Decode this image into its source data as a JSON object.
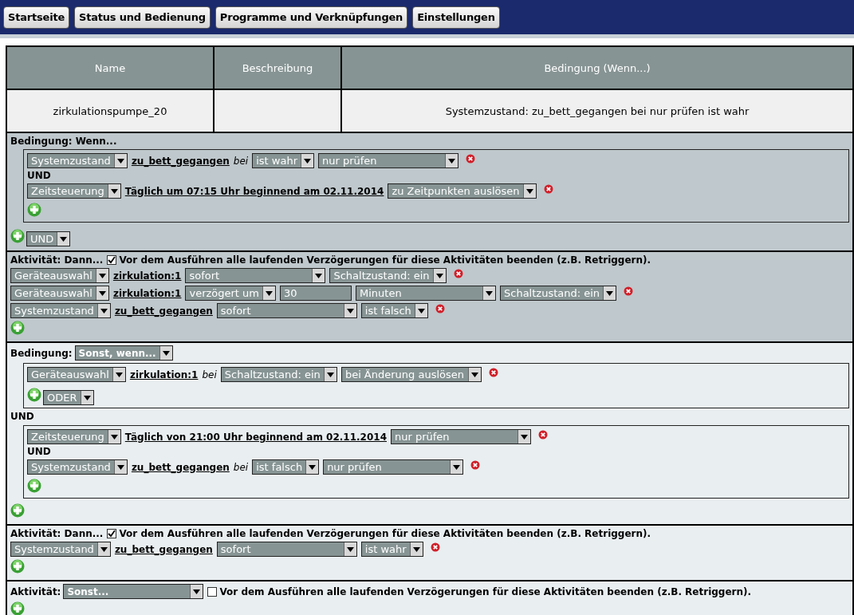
{
  "nav": [
    "Startseite",
    "Status und Bedienung",
    "Programme und Verknüpfungen",
    "Einstellungen"
  ],
  "table": {
    "columns": [
      "Name",
      "Beschreibung",
      "Bedingung (Wenn...)"
    ],
    "rows": [
      {
        "name": "zirkulationspumpe_20",
        "condition": "Systemzustand: zu_bett_gegangen bei nur prüfen ist wahr"
      }
    ]
  },
  "sections": [
    {
      "kind": "condition",
      "color": "#bfc8cc",
      "label": "Bedingung: Wenn...",
      "body": [
        {
          "kind": "group",
          "lines": [
            {
              "kind": "row",
              "parts": [
                {
                  "kind": "select",
                  "value": "Systemzustand"
                },
                {
                  "kind": "link",
                  "text": "zu_bett_gegangen"
                },
                {
                  "kind": "italic",
                  "text": "bei"
                },
                {
                  "kind": "select",
                  "value": "ist wahr"
                },
                {
                  "kind": "select",
                  "value": "nur prüfen",
                  "wide": true
                }
              ]
            },
            {
              "kind": "joiner",
              "text": "UND"
            },
            {
              "kind": "row",
              "parts": [
                {
                  "kind": "select",
                  "value": "Zeitsteuerung"
                },
                {
                  "kind": "link",
                  "text": "Täglich um 07:15 Uhr beginnend am 02.11.2014"
                },
                {
                  "kind": "select",
                  "value": "zu Zeitpunkten auslösen"
                }
              ]
            }
          ]
        }
      ],
      "operator": "UND"
    },
    {
      "kind": "activity",
      "color": "#bfc8cc",
      "label": "Aktivität: Dann...",
      "checked": true,
      "option": "Vor dem Ausführen alle laufenden Verzögerungen für diese Aktivitäten beenden (z.B. Retriggern).",
      "rows": [
        {
          "kind": "row",
          "parts": [
            {
              "kind": "select",
              "value": "Geräteauswahl"
            },
            {
              "kind": "link",
              "text": "zirkulation:1"
            },
            {
              "kind": "select",
              "value": "sofort",
              "wide": true
            },
            {
              "kind": "select",
              "value": "Schaltzustand: ein"
            }
          ]
        },
        {
          "kind": "row",
          "parts": [
            {
              "kind": "select",
              "value": "Geräteauswahl"
            },
            {
              "kind": "link",
              "text": "zirkulation:1"
            },
            {
              "kind": "select",
              "value": "verzögert um"
            },
            {
              "kind": "input",
              "value": "30"
            },
            {
              "kind": "select",
              "value": "Minuten",
              "wide": true
            },
            {
              "kind": "select",
              "value": "Schaltzustand: ein"
            }
          ]
        },
        {
          "kind": "row",
          "parts": [
            {
              "kind": "select",
              "value": "Systemzustand"
            },
            {
              "kind": "link",
              "text": "zu_bett_gegangen"
            },
            {
              "kind": "select",
              "value": "sofort",
              "wide": true
            },
            {
              "kind": "select",
              "value": "ist falsch"
            }
          ]
        }
      ]
    },
    {
      "kind": "condition",
      "color": "#e9eef0",
      "label": "Bedingung:",
      "mode": "Sonst, wenn...",
      "body": [
        {
          "kind": "group",
          "lines": [
            {
              "kind": "row",
              "parts": [
                {
                  "kind": "select",
                  "value": "Geräteauswahl"
                },
                {
                  "kind": "link",
                  "text": "zirkulation:1"
                },
                {
                  "kind": "italic",
                  "text": "bei"
                },
                {
                  "kind": "select",
                  "value": "Schaltzustand: ein"
                },
                {
                  "kind": "select",
                  "value": "bei Änderung auslösen",
                  "wide": true
                }
              ]
            }
          ],
          "operator": "ODER"
        },
        {
          "kind": "joiner",
          "text": "UND"
        },
        {
          "kind": "group",
          "lines": [
            {
              "kind": "row",
              "parts": [
                {
                  "kind": "select",
                  "value": "Zeitsteuerung"
                },
                {
                  "kind": "link",
                  "text": "Täglich von 21:00 Uhr beginnend am 02.11.2014"
                },
                {
                  "kind": "select",
                  "value": "nur prüfen",
                  "wide": true
                }
              ]
            },
            {
              "kind": "joiner",
              "text": "UND"
            },
            {
              "kind": "row",
              "parts": [
                {
                  "kind": "select",
                  "value": "Systemzustand"
                },
                {
                  "kind": "link",
                  "text": "zu_bett_gegangen"
                },
                {
                  "kind": "italic",
                  "text": "bei"
                },
                {
                  "kind": "select",
                  "value": "ist falsch"
                },
                {
                  "kind": "select",
                  "value": "nur prüfen",
                  "wide": true
                }
              ]
            }
          ]
        }
      ]
    },
    {
      "kind": "activity",
      "color": "#e9eef0",
      "label": "Aktivität: Dann...",
      "checked": true,
      "option": "Vor dem Ausführen alle laufenden Verzögerungen für diese Aktivitäten beenden (z.B. Retriggern).",
      "rows": [
        {
          "kind": "row",
          "parts": [
            {
              "kind": "select",
              "value": "Systemzustand"
            },
            {
              "kind": "link",
              "text": "zu_bett_gegangen"
            },
            {
              "kind": "select",
              "value": "sofort",
              "wide": true
            },
            {
              "kind": "select",
              "value": "ist wahr"
            }
          ]
        }
      ]
    },
    {
      "kind": "activity",
      "color": "#e9eef0",
      "label": "Aktivität:",
      "mode": "Sonst...",
      "checked": false,
      "option": "Vor dem Ausführen alle laufenden Verzögerungen für diese Aktivitäten beenden (z.B. Retriggern)."
    }
  ]
}
